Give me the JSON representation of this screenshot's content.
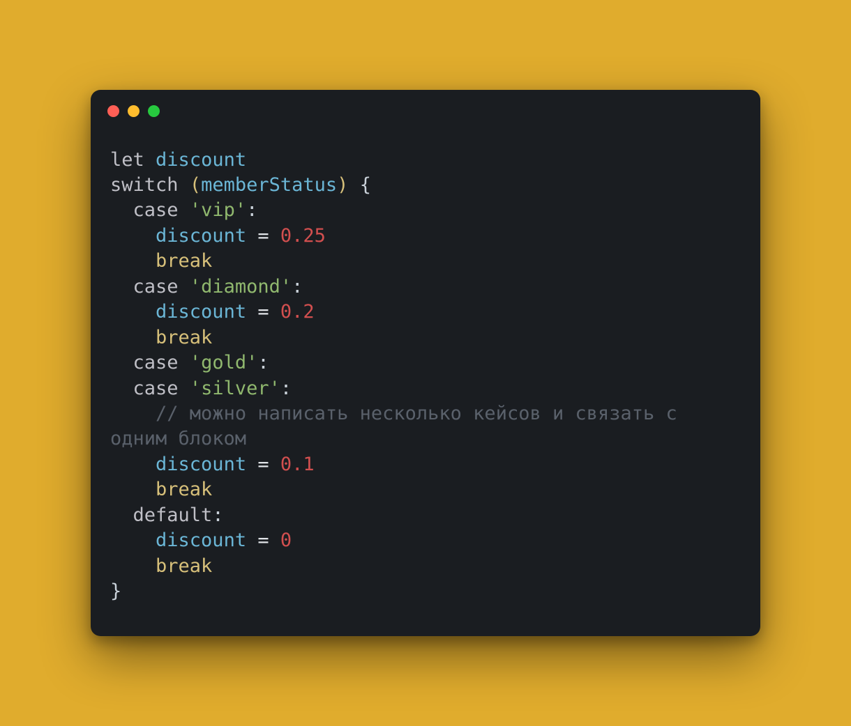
{
  "window": {
    "dots": [
      "red",
      "yellow",
      "green"
    ]
  },
  "tokens": {
    "let": "let",
    "switch": "switch",
    "case": "case",
    "break": "break",
    "default": "default",
    "discount": "discount",
    "memberStatus": "memberStatus",
    "eq": "=",
    "colon": ":",
    "lparen": "(",
    "rparen": ")",
    "lbrace": "{",
    "rbrace": "}",
    "str_vip": "'vip'",
    "str_diamond": "'diamond'",
    "str_gold": "'gold'",
    "str_silver": "'silver'",
    "num_025": "0.25",
    "num_02": "0.2",
    "num_01": "0.1",
    "num_0": "0",
    "comment": "// можно написать несколько кейсов и связать с одним блоком"
  }
}
